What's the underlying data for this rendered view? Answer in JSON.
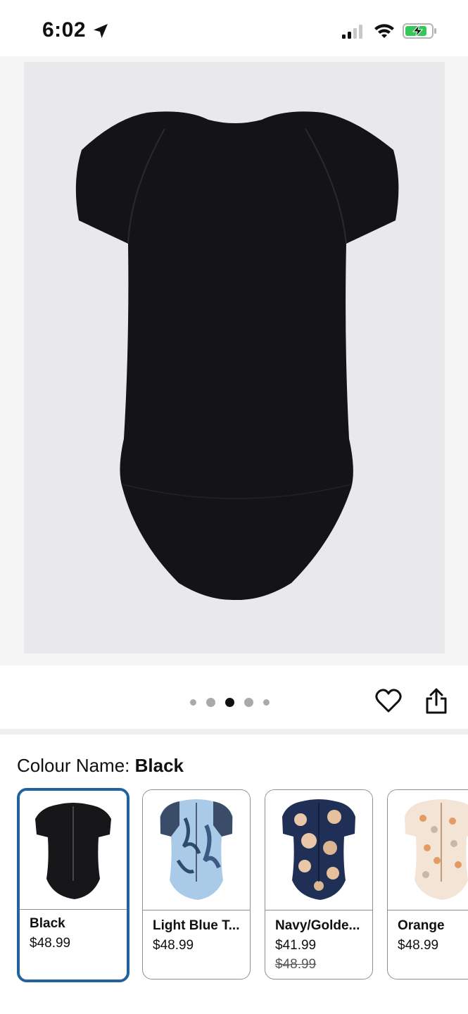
{
  "status_bar": {
    "time": "6:02",
    "icons": [
      "location-arrow-icon",
      "cellular-signal-icon",
      "wifi-icon",
      "battery-charging-icon"
    ],
    "battery_color": "#34c759"
  },
  "gallery": {
    "image_label": "Black short sleeve one-piece swimsuit, back view",
    "dot_count": 5,
    "active_dot_index": 2
  },
  "actions": {
    "wishlist_icon": "heart-icon",
    "share_icon": "share-icon"
  },
  "colour": {
    "label": "Colour Name: ",
    "selected_value": "Black",
    "selected_border_color": "#2162a1",
    "options": [
      {
        "name": "Black",
        "price": "$48.99",
        "old_price": ""
      },
      {
        "name": "Light Blue T...",
        "price": "$48.99",
        "old_price": ""
      },
      {
        "name": "Navy/Golde...",
        "price": "$41.99",
        "old_price": "$48.99"
      },
      {
        "name": "Orange",
        "price": "$48.99",
        "old_price": ""
      }
    ]
  }
}
